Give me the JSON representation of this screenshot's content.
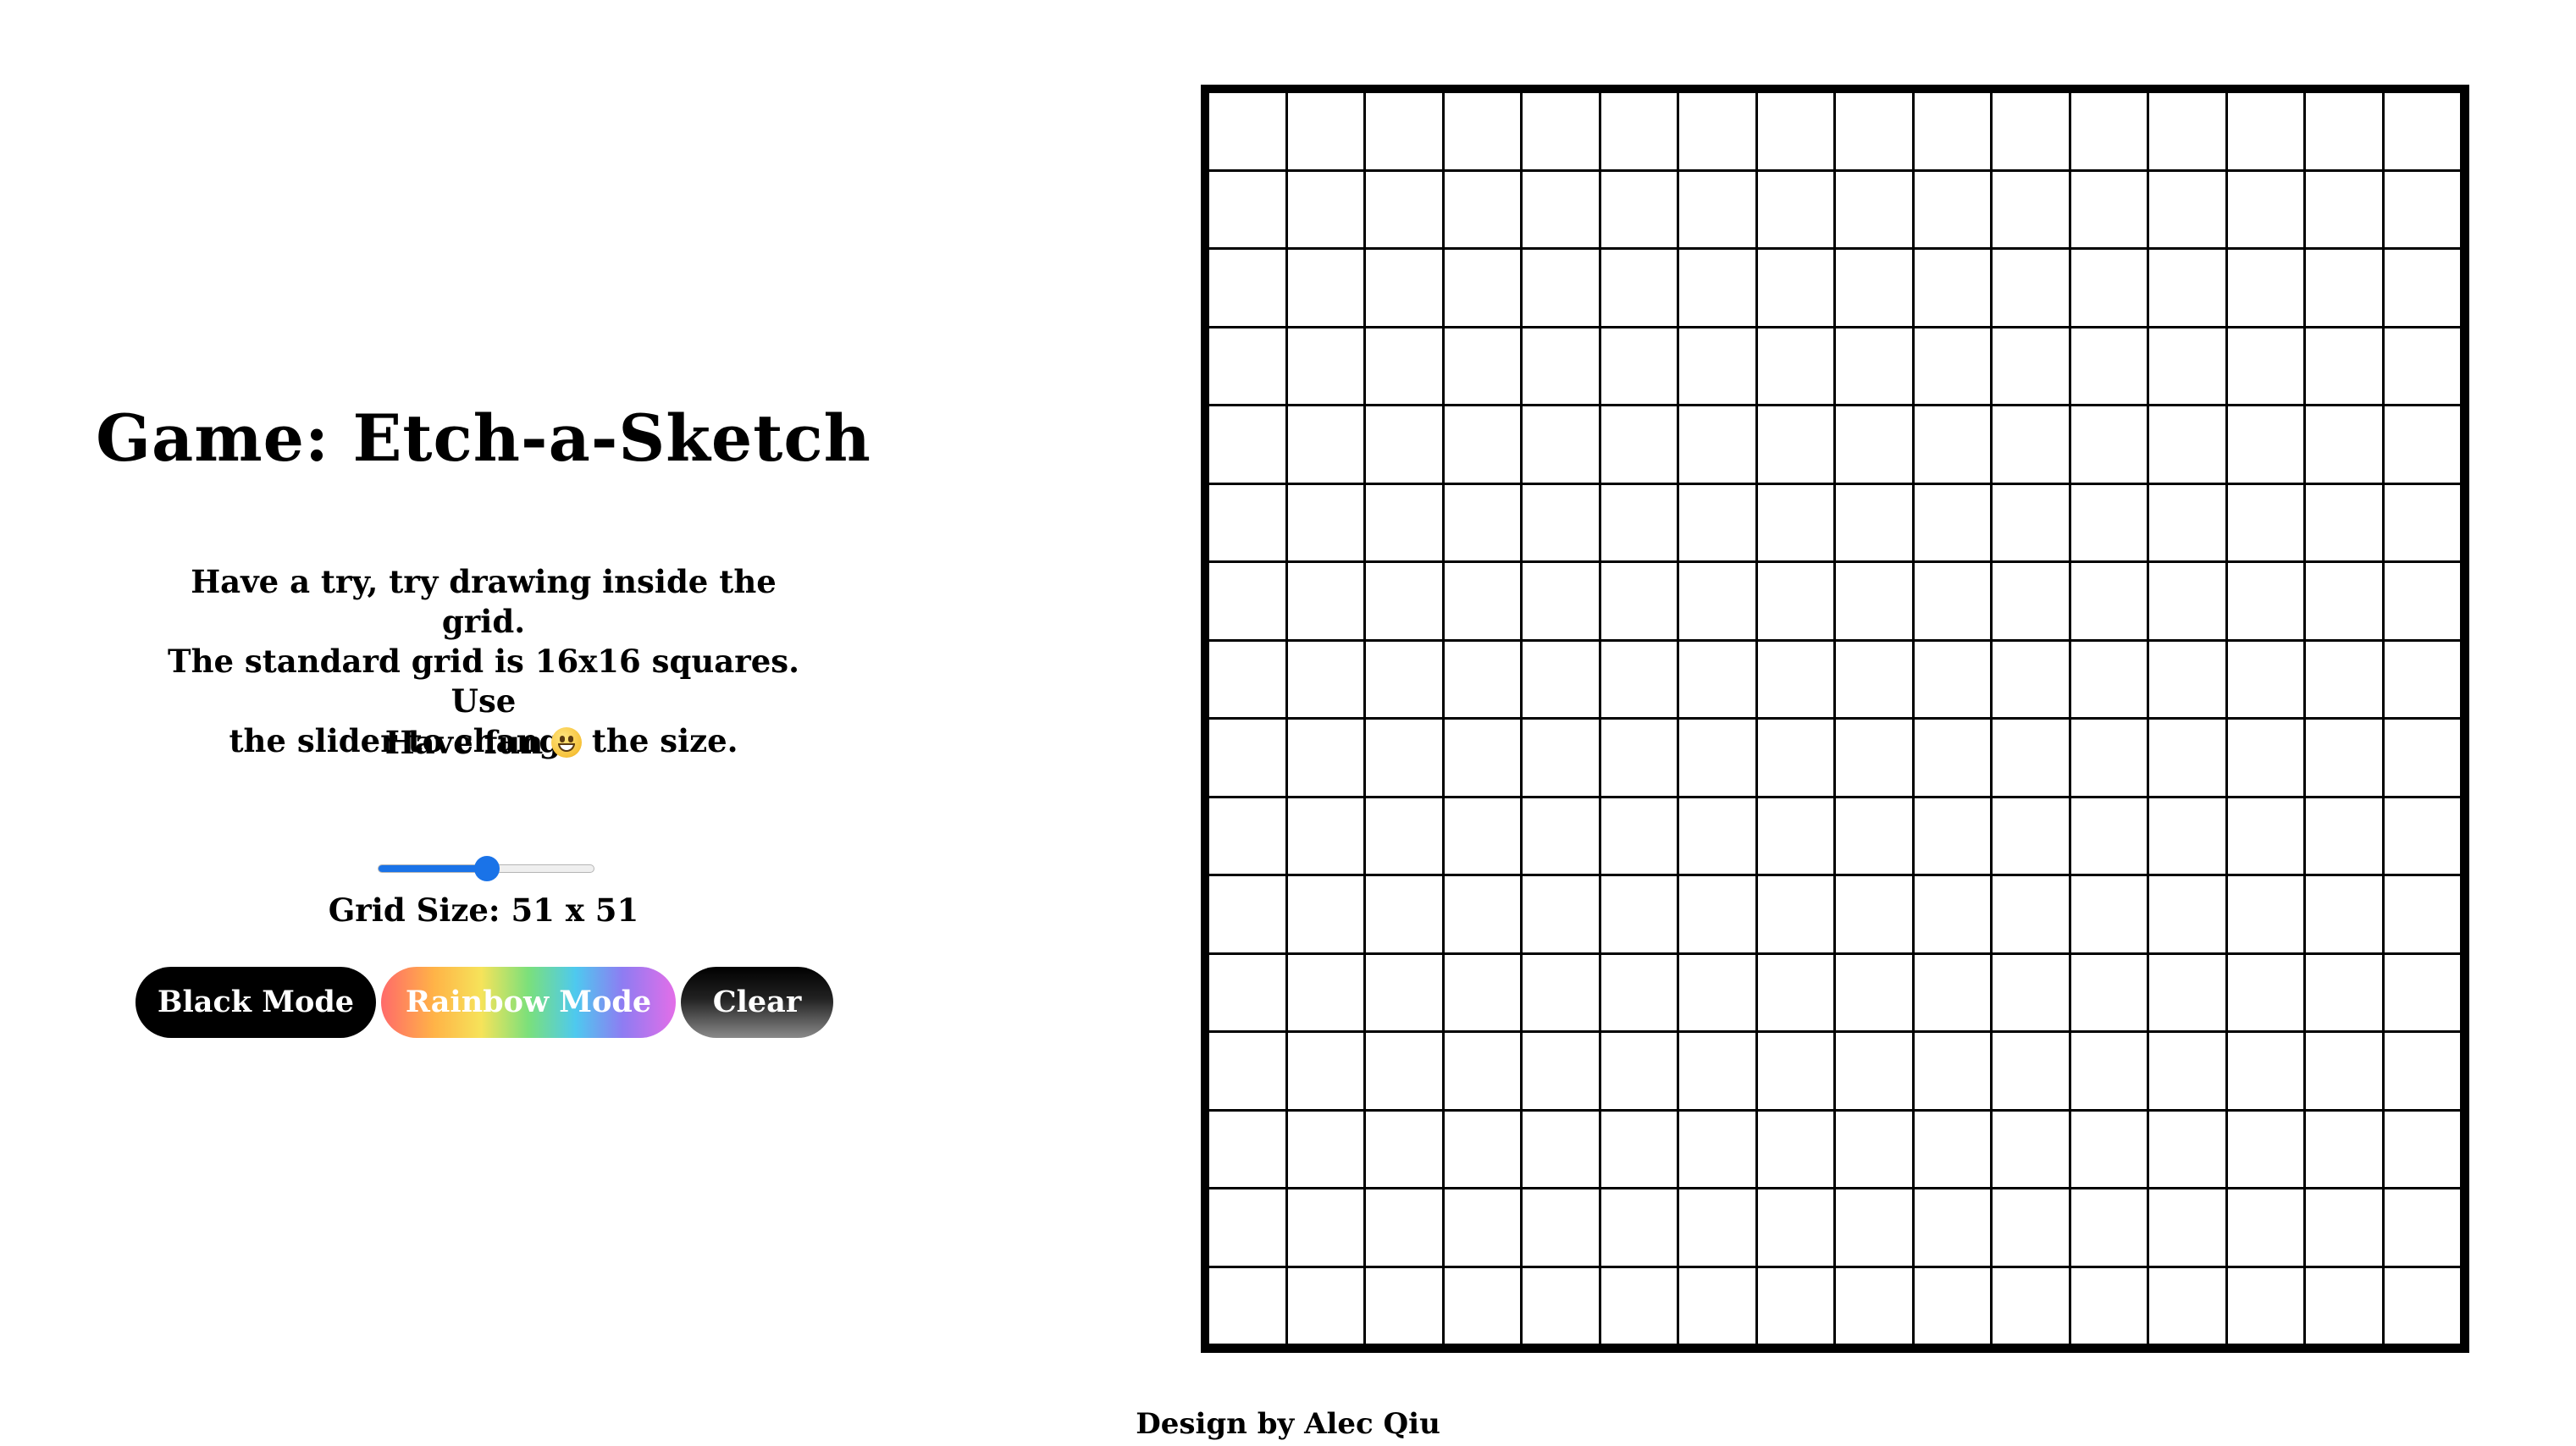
{
  "title": "Game: Etch-a-Sketch",
  "instructions": {
    "lines": [
      "Have a try, try drawing inside the grid.",
      "The standard grid is 16x16 squares. Use",
      "the slider to change the size."
    ],
    "fun": "Have fun",
    "fun_emoji": "grinning-face-icon"
  },
  "slider": {
    "min": 1,
    "max": 100,
    "value": 51
  },
  "grid_size_label": "Grid Size: 51 x 51",
  "buttons": {
    "black_mode": "Black Mode",
    "rainbow_mode": "Rainbow Mode",
    "clear": "Clear"
  },
  "board": {
    "columns": 16,
    "rows": 16,
    "cell_color": "#ffffff",
    "line_color": "#000000"
  },
  "colors": {
    "accent": "#1a73e8",
    "black_button": "#000000"
  },
  "footer": "Design by Alec Qiu"
}
